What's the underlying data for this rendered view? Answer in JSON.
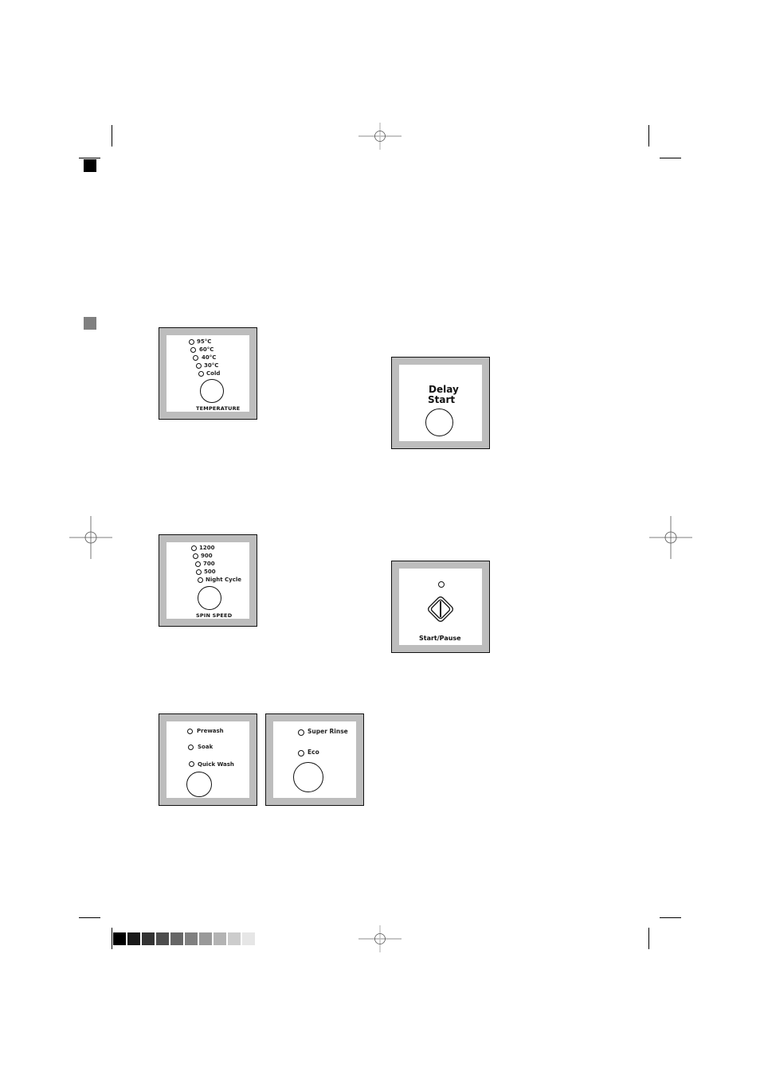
{
  "page": {
    "section_markers": [
      {
        "name": "black-section-marker",
        "color": "#000000"
      },
      {
        "name": "gray-section-marker",
        "color": "#808080"
      }
    ],
    "color_bar": [
      "#000000",
      "#1a1a1a",
      "#333333",
      "#4d4d4d",
      "#666666",
      "#808080",
      "#999999",
      "#b3b3b3",
      "#cccccc",
      "#e6e6e6"
    ]
  },
  "panels": {
    "temperature": {
      "options": [
        "95°C",
        "60°C",
        "40°C",
        "30°C",
        "Cold"
      ],
      "caption": "TEMPERATURE"
    },
    "spin_speed": {
      "options": [
        "1200",
        "900",
        "700",
        "500",
        "Night Cycle"
      ],
      "caption": "SPIN SPEED"
    },
    "options_a": {
      "options": [
        "Prewash",
        "Soak",
        "Quick Wash"
      ]
    },
    "options_b": {
      "options": [
        "Super Rinse",
        "Eco"
      ]
    },
    "delay_start": {
      "label_line1": "Delay",
      "label_line2": "Start"
    },
    "start_pause": {
      "caption": "Start/Pause"
    }
  }
}
